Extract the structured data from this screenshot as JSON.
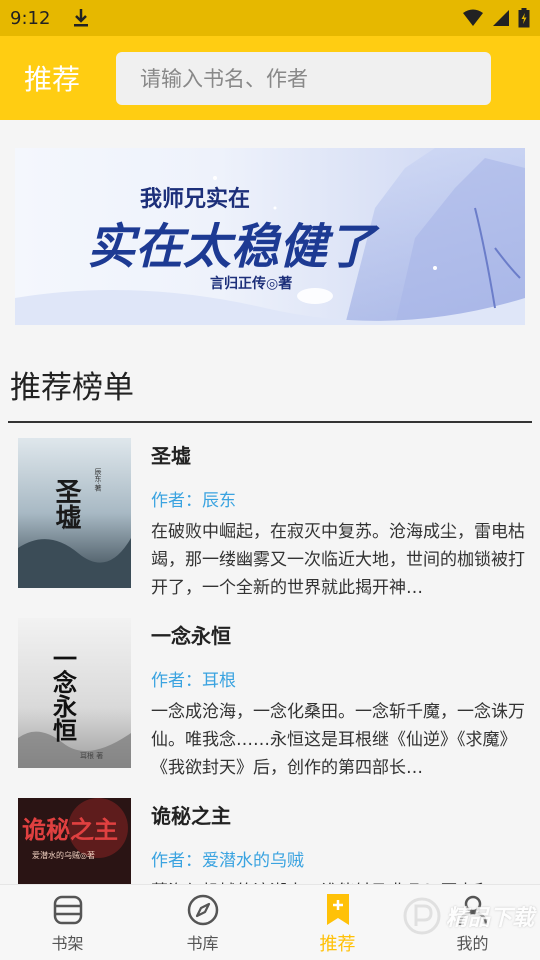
{
  "status_bar": {
    "time": "9:12"
  },
  "header": {
    "title": "推荐",
    "search_placeholder": "请输入书名、作者"
  },
  "banner": {
    "line1": "我师兄实在",
    "line2": "实在太稳健了",
    "byline": "言归正传◎著"
  },
  "section": {
    "title": "推荐榜单"
  },
  "books": [
    {
      "title": "圣墟",
      "author": "作者：辰东",
      "desc": "在破败中崛起，在寂灭中复苏。沧海成尘，雷电枯竭，那一缕幽雾又一次临近大地，世间的枷锁被打开了，一个全新的世界就此揭开神…",
      "cover_text": "圣墟",
      "cover_sub": "辰东·著"
    },
    {
      "title": "一念永恒",
      "author": "作者：耳根",
      "desc": "一念成沧海，一念化桑田。一念斩千魔，一念诛万仙。唯我念……永恒这是耳根继《仙逆》《求魔》《我欲封天》后，创作的第四部长…",
      "cover_text": "一念永恒",
      "cover_sub": "耳根 著"
    },
    {
      "title": "诡秘之主",
      "author": "作者：爱潜水的乌贼",
      "desc": "蒸汽与机械的浪潮中，谁能触及非凡？历史和…",
      "cover_text": "诡秘之主",
      "cover_sub": "爱潜水的乌贼◎著"
    }
  ],
  "nav": [
    {
      "label": "书架",
      "icon": "bookshelf-icon"
    },
    {
      "label": "书库",
      "icon": "compass-icon"
    },
    {
      "label": "推荐",
      "icon": "bookmark-icon"
    },
    {
      "label": "我的",
      "icon": "user-icon"
    }
  ],
  "watermark": {
    "text": "精品下载"
  },
  "colors": {
    "header": "#ffcd12",
    "status_bar": "#e6b800",
    "author": "#3aa3e0",
    "active_nav": "#ffc107"
  }
}
